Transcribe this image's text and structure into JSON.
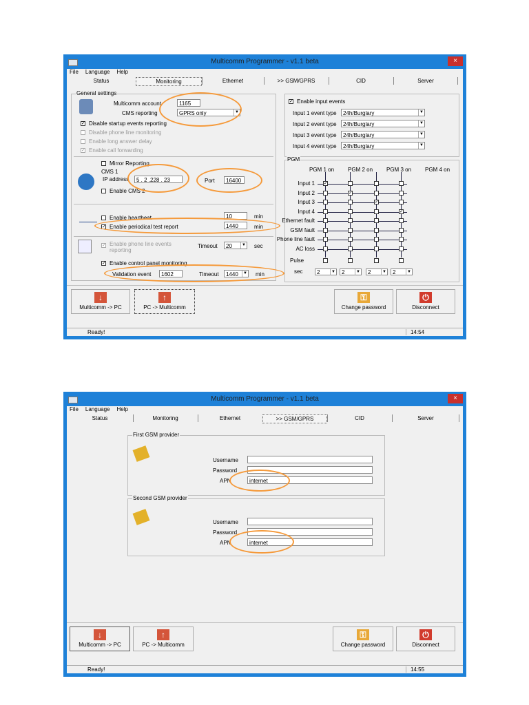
{
  "window": {
    "title": "Multicomm Programmer -  v1.1 beta",
    "close": "×"
  },
  "menu": [
    "File",
    "Language",
    "Help"
  ],
  "tabs": [
    "Status",
    "Monitoring",
    "Ethernet",
    ">> GSM/GPRS",
    "CID",
    "Server"
  ],
  "monitoring": {
    "general_settings": "General settings",
    "account_label": "Multicomm account",
    "account_value": "1165",
    "cms_reporting_label": "CMS reporting",
    "cms_reporting_value": "GPRS only",
    "disable_startup": "Disable startup events reporting",
    "disable_phone": "Disable phone line monitoring",
    "enable_long_answer": "Enable long answer delay",
    "enable_call_fwd": "Enable call forwarding",
    "mirror": "Mirror Reporting",
    "cms1": "CMS 1",
    "ip_label": "IP address",
    "ip_value": "5  .  2  .228 . 23",
    "port_label": "Port",
    "port_value": "16400",
    "enable_cms2": "Enable CMS 2",
    "heartbeat": "Enable heartbeat",
    "heartbeat_val": "10",
    "periodic": "Enable periodical test report",
    "periodic_val": "1440",
    "min": "min",
    "phone_events": "Enable phone line events reporting",
    "timeout": "Timeout",
    "timeout_val": "20",
    "sec": "sec",
    "control_panel": "Enable control panel monitoring",
    "validation_label": "Validation event",
    "validation_val": "1602",
    "timeout2_val": "1440",
    "enable_input_events": "Enable input events",
    "inputs": [
      {
        "label": "Input 1 event type",
        "value": "24h/Burglary"
      },
      {
        "label": "Input 2 event type",
        "value": "24h/Burglary"
      },
      {
        "label": "Input 3 event type",
        "value": "24h/Burglary"
      },
      {
        "label": "Input 4 event type",
        "value": "24h/Burglary"
      }
    ],
    "pgm": "PGM",
    "pgm_headers": [
      "PGM 1 on",
      "PGM 2 on",
      "PGM 3 on",
      "PGM 4 on"
    ],
    "pgm_rows": [
      "Input 1",
      "Input 2",
      "Input 3",
      "Input 4",
      "Ethernet fault",
      "GSM fault",
      "Phone line fault",
      "AC loss"
    ],
    "pulse": "Pulse",
    "sec_label": "sec",
    "pulse_vals": [
      "2",
      "2",
      "2",
      "2"
    ],
    "status": "Ready!",
    "time": "14:54"
  },
  "buttons": {
    "mc_to_pc": "Multicomm -> PC",
    "pc_to_mc": "PC -> Multicomm",
    "change_pw": "Change password",
    "disconnect": "Disconnect"
  },
  "gsm": {
    "first": "First GSM provider",
    "second": "Second GSM provider",
    "username": "Username",
    "password": "Password",
    "apn": "APN",
    "apn1": "internet",
    "apn2": "internet",
    "status": "Ready!",
    "time": "14:55"
  },
  "colors": {
    "accent": "#1e81d8",
    "highlight": "#f59a3b",
    "close": "#c9302c"
  }
}
